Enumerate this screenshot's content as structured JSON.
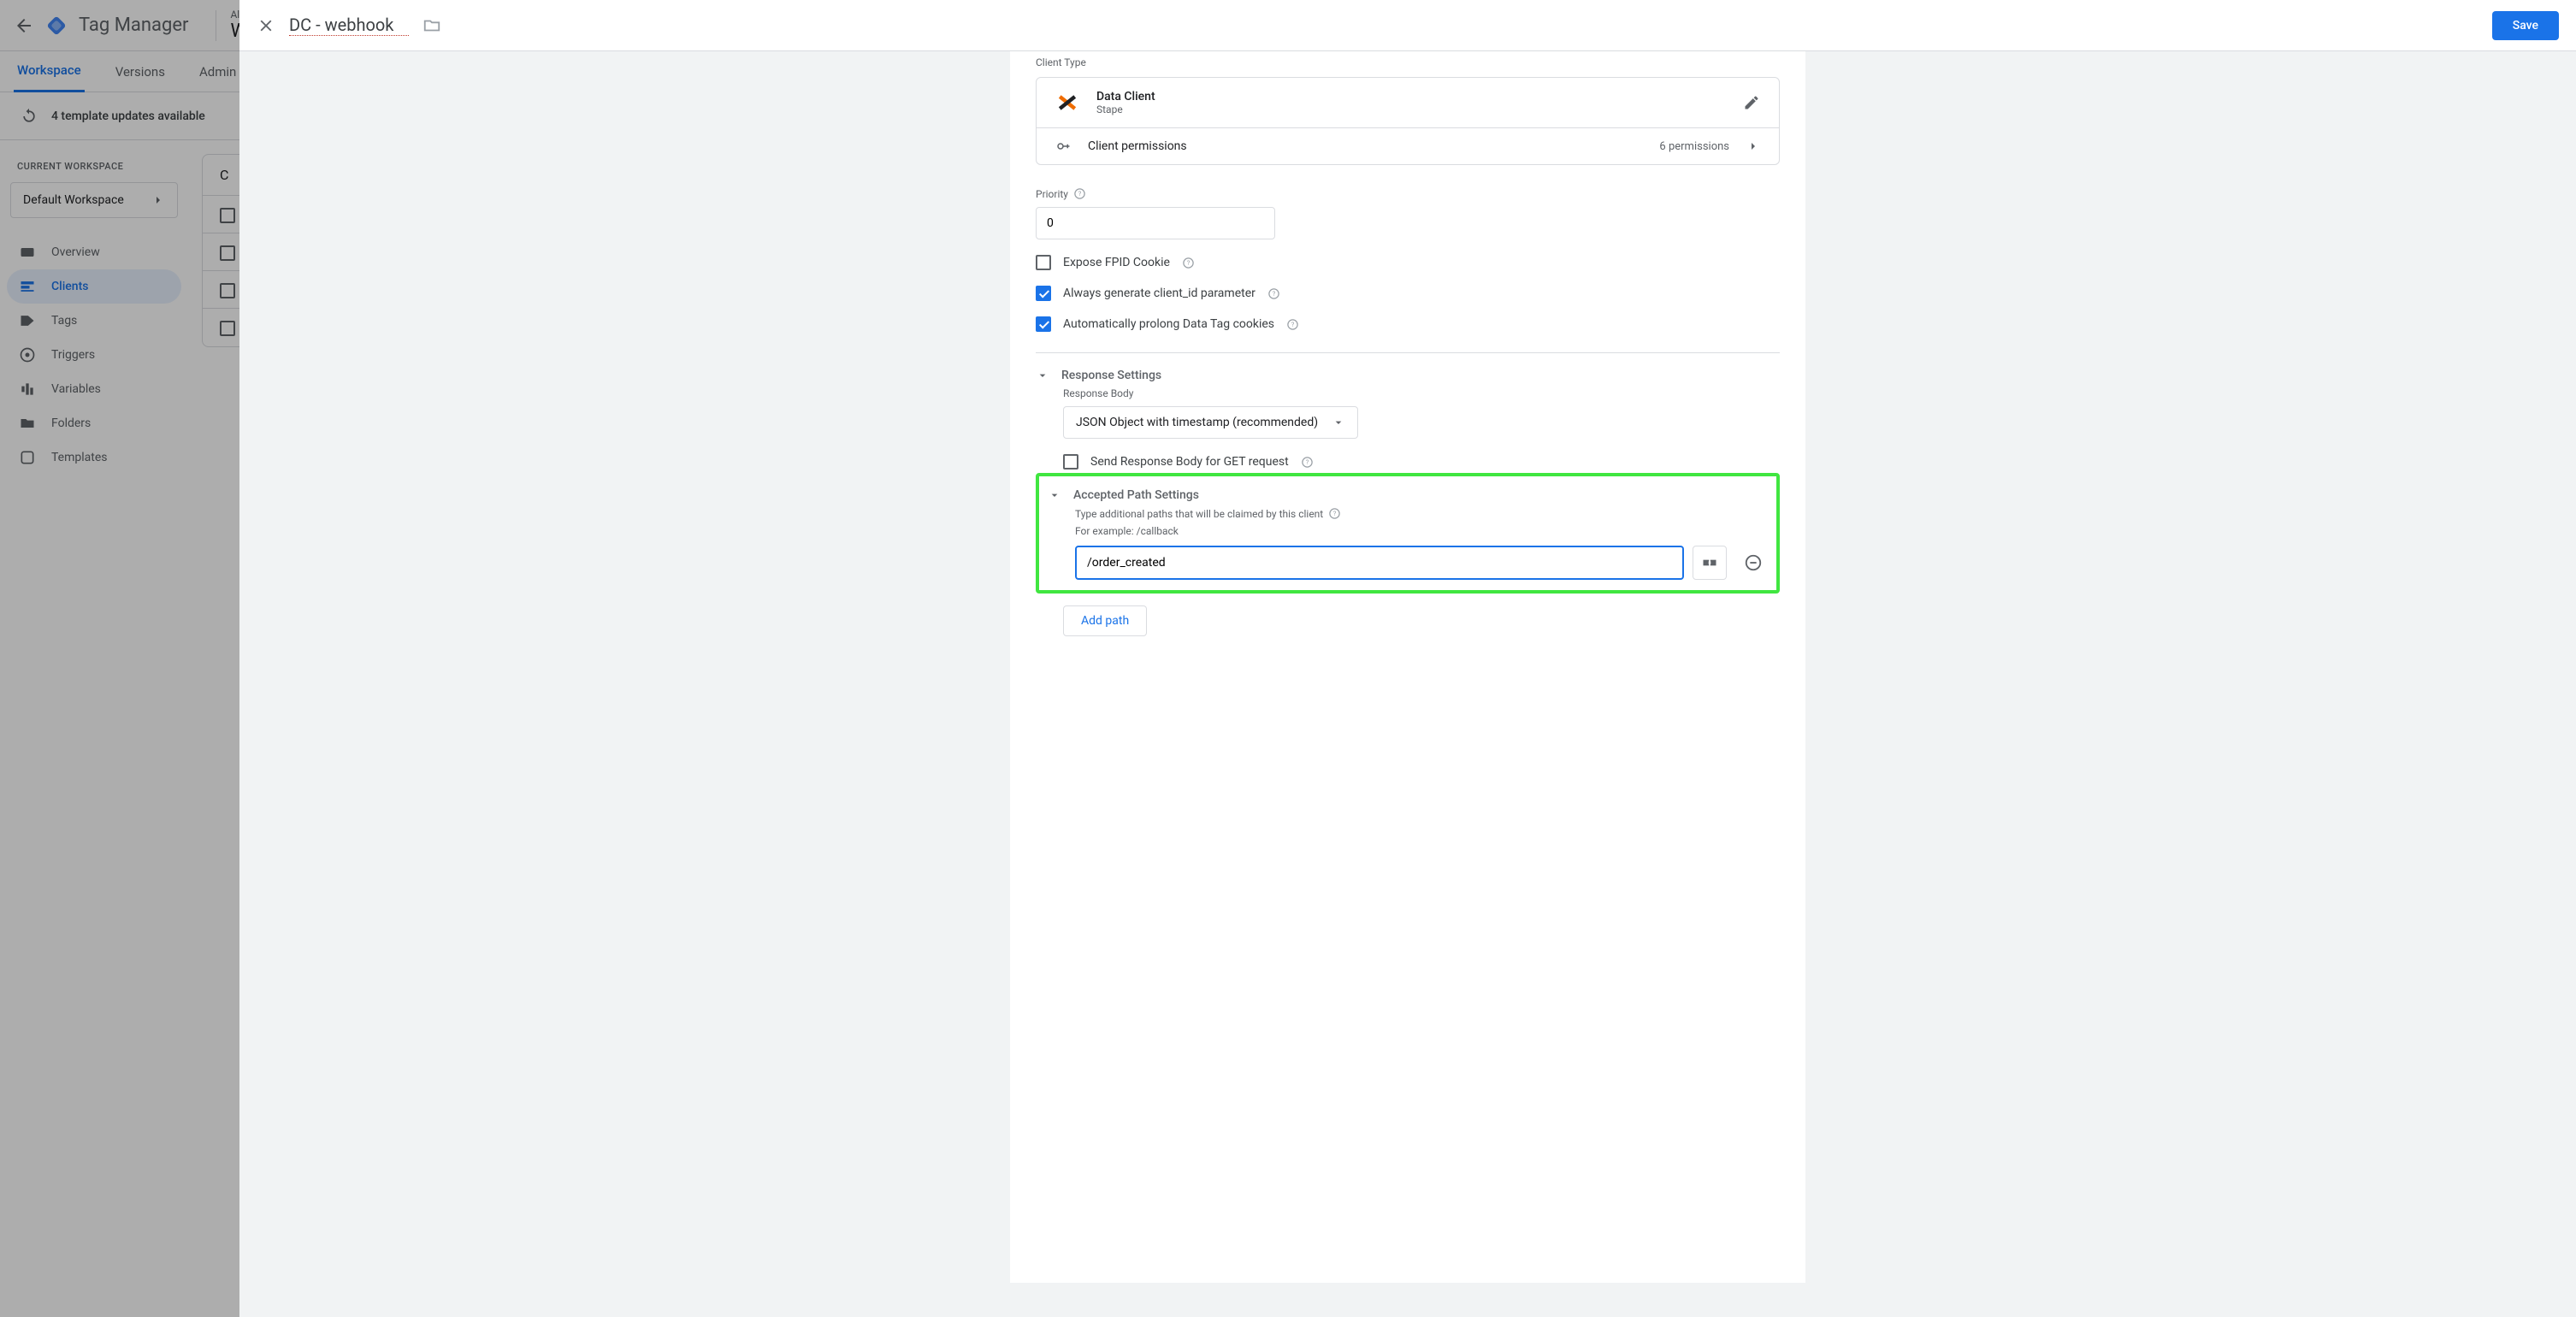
{
  "header": {
    "app_title": "Tag Manager",
    "accounts_label": "All a",
    "workspace_big": "W"
  },
  "tabs": {
    "workspace": "Workspace",
    "versions": "Versions",
    "admin": "Admin"
  },
  "banner": {
    "updates": "4 template updates available"
  },
  "sidebar": {
    "ws_heading": "CURRENT WORKSPACE",
    "ws_name": "Default Workspace",
    "items": [
      {
        "label": "Overview",
        "icon": "overview-icon"
      },
      {
        "label": "Clients",
        "icon": "clients-icon",
        "active": true
      },
      {
        "label": "Tags",
        "icon": "tags-icon"
      },
      {
        "label": "Triggers",
        "icon": "triggers-icon"
      },
      {
        "label": "Variables",
        "icon": "variables-icon"
      },
      {
        "label": "Folders",
        "icon": "folders-icon"
      },
      {
        "label": "Templates",
        "icon": "templates-icon"
      }
    ]
  },
  "list": {
    "title": "C"
  },
  "modal": {
    "title": "DC - webhook",
    "save": "Save",
    "client_type_label": "Client Type",
    "client": {
      "name": "Data Client",
      "provider": "Stape",
      "permissions_label": "Client permissions",
      "permissions_count": "6 permissions"
    },
    "priority": {
      "label": "Priority",
      "value": "0"
    },
    "checks": {
      "expose_fpid": "Expose FPID Cookie",
      "always_client_id": "Always generate client_id parameter",
      "auto_prolong": "Automatically prolong Data Tag cookies"
    },
    "response": {
      "title": "Response Settings",
      "body_label": "Response Body",
      "body_value": "JSON Object with timestamp (recommended)",
      "send_get": "Send Response Body for GET request"
    },
    "paths": {
      "title": "Accepted Path Settings",
      "hint": "Type additional paths that will be claimed by this client",
      "example": "For example: /callback",
      "value": "/order_created",
      "add_label": "Add path"
    }
  }
}
